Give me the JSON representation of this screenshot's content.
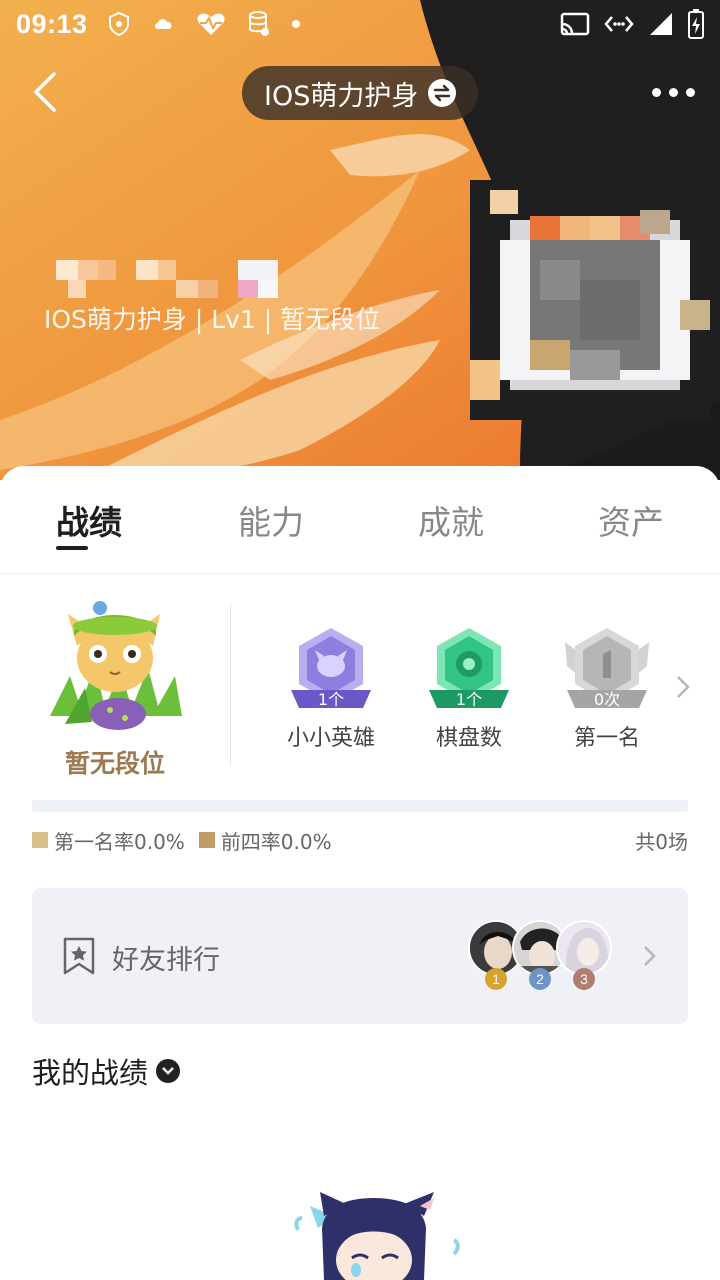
{
  "statusbar": {
    "time": "09:13",
    "icons": [
      "shield-icon",
      "cloud-icon",
      "heart-pulse-icon",
      "database-icon",
      "dot-icon"
    ],
    "right_icons": [
      "cast-icon",
      "data-arrows-icon",
      "signal-icon",
      "battery-charging-icon"
    ]
  },
  "nav": {
    "title": "IOS萌力护身",
    "back_icon": "back-chevron-icon",
    "swap_icon": "swap-icon",
    "more_icon": "more-dots-icon"
  },
  "profile": {
    "subtitle": "IOS萌力护身 | Lv1 | 暂无段位"
  },
  "tabs": [
    {
      "label": "战绩",
      "active": true
    },
    {
      "label": "能力",
      "active": false
    },
    {
      "label": "成就",
      "active": false
    },
    {
      "label": "资产",
      "active": false
    }
  ],
  "rank": {
    "label": "暂无段位"
  },
  "badges": [
    {
      "name": "小小英雄",
      "count": "1个",
      "color": "#8f7ee0"
    },
    {
      "name": "棋盘数",
      "count": "1个",
      "color": "#32c486"
    },
    {
      "name": "第一名",
      "count": "0次",
      "color": "#b6b6b6"
    }
  ],
  "stats": {
    "first_rate": "第一名率0.0%",
    "top4_rate": "前四率0.0%",
    "total": "共0场",
    "first_color": "#d9bf8a",
    "top4_color": "#c29a63"
  },
  "friends": {
    "label": "好友排行",
    "ranks": [
      "1",
      "2",
      "3"
    ],
    "rank_colors": [
      "#d9a22e",
      "#6d94c8",
      "#b07d6e"
    ]
  },
  "records": {
    "label": "我的战绩"
  }
}
